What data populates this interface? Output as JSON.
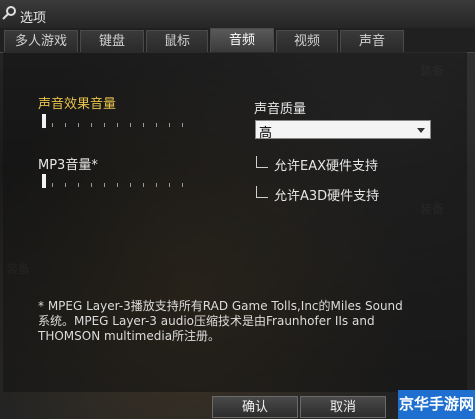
{
  "window": {
    "title": "选项"
  },
  "tabs": [
    {
      "label": "多人游戏"
    },
    {
      "label": "键盘"
    },
    {
      "label": "鼠标"
    },
    {
      "label": "音频"
    },
    {
      "label": "视频"
    },
    {
      "label": "声音"
    }
  ],
  "active_tab": "音频",
  "audio": {
    "effects_volume_label": "声音效果音量",
    "mp3_volume_label": "MP3音量*",
    "quality_label": "声音质量",
    "quality_value": "高",
    "eax_label": "允许EAX硬件支持",
    "a3d_label": "允许A3D硬件支持",
    "eax_checked": false,
    "a3d_checked": false,
    "effects_volume": 0,
    "mp3_volume": 0
  },
  "footnote": {
    "line1": "* MPEG Layer-3播放支持所有RAD Game Tolls,Inc的Miles Sound",
    "line2": "系统。MPEG Layer-3 audio压缩技术是由Fraunhofer IIs and",
    "line3": "THOMSON multimedia所注册。"
  },
  "buttons": {
    "ok": "确认",
    "cancel": "取消"
  },
  "watermark": {
    "text": "京华手游网"
  },
  "colors": {
    "label_gold": "#e8c24a",
    "watermark_blue": "#1e6fd0"
  }
}
